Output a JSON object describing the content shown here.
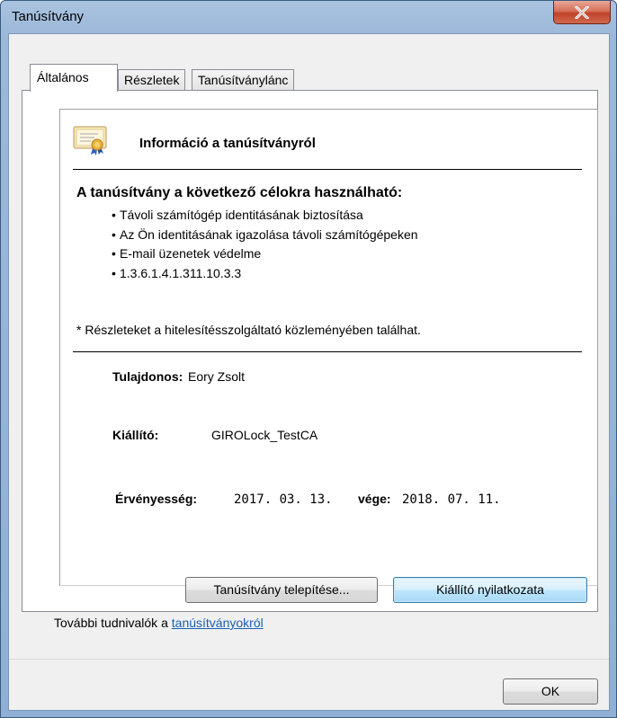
{
  "window": {
    "title": "Tanúsítvány"
  },
  "tabs": [
    {
      "label": "Általános",
      "active": true
    },
    {
      "label": "Részletek",
      "active": false
    },
    {
      "label": "Tanúsítványlánc",
      "active": false
    }
  ],
  "general": {
    "info_title": "Információ a tanúsítványról",
    "purpose_title": "A tanúsítvány a következő célokra használható:",
    "purposes": [
      "Távoli számítógép identitásának biztosítása",
      "Az Ön identitásának igazolása távoli számítógépeken",
      "E-mail üzenetek védelme",
      "1.3.6.1.4.1.311.10.3.3"
    ],
    "bullet": "•",
    "note": "* Részleteket a hitelesítésszolgáltató közleményében találhat.",
    "owner_label": "Tulajdonos:",
    "owner_value": "Eory Zsolt",
    "issuer_label": "Kiállító:",
    "issuer_value": "GIROLock_TestCA",
    "validity_label": "Érvényesség:",
    "valid_from": "2017. 03. 13.",
    "valid_to_label": "vége:",
    "valid_to": "2018. 07. 11."
  },
  "buttons": {
    "install": "Tanúsítvány telepítése...",
    "issuer_statement": "Kiállító nyilatkozata",
    "ok": "OK"
  },
  "footer": {
    "text": "További tudnivalók a ",
    "link": "tanúsítványokról"
  },
  "colors": {
    "link": "#1a5fb4",
    "close_button": "#c0432a",
    "title_bar": "#9cb8d8"
  }
}
